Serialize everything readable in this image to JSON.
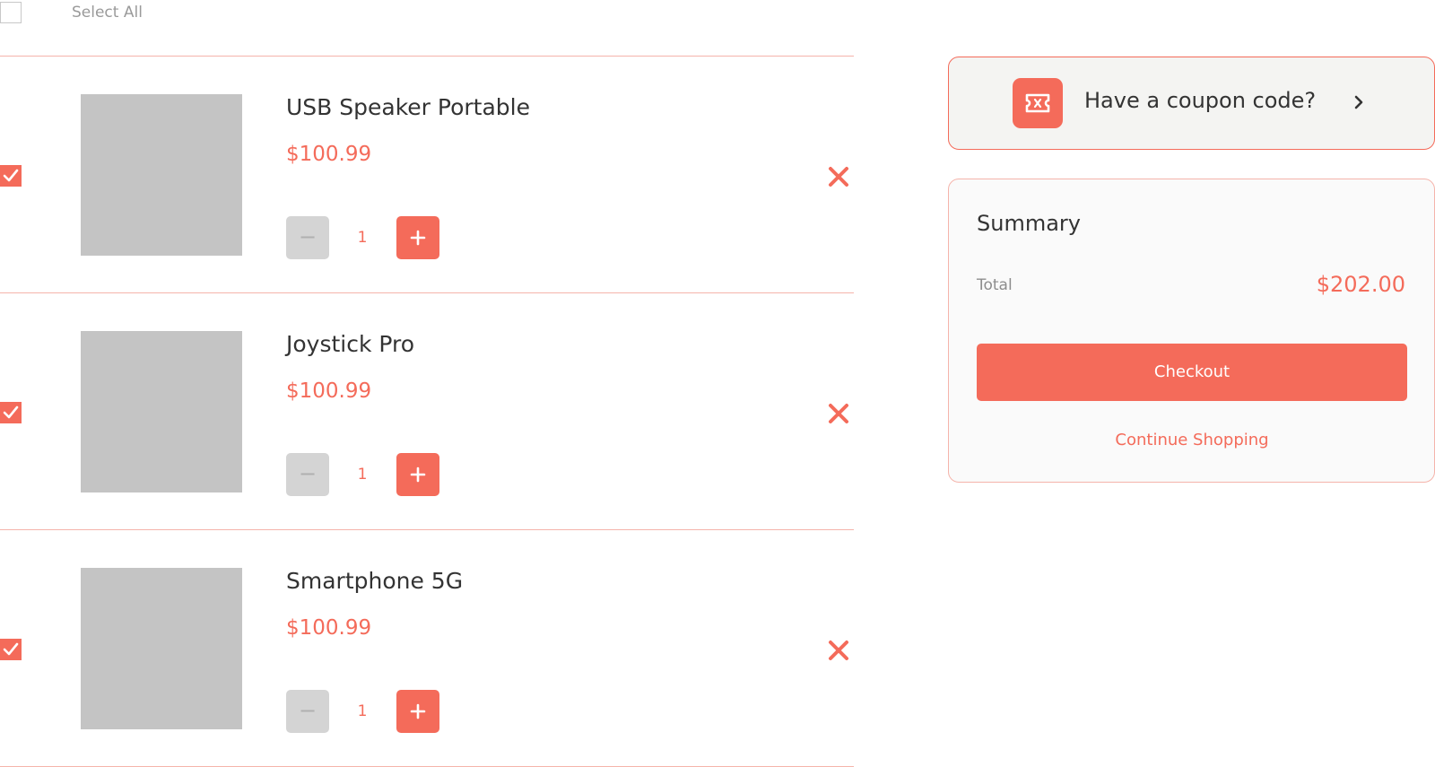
{
  "select_all": {
    "label": "Select All",
    "checked": false
  },
  "cart": {
    "items": [
      {
        "name": "USB Speaker Portable",
        "price": "$100.99",
        "quantity": "1",
        "selected": true,
        "minus_label": "−",
        "remove_icon": "close-icon",
        "plus_icon": "plus-icon"
      },
      {
        "name": "Joystick Pro",
        "price": "$100.99",
        "quantity": "1",
        "selected": true,
        "minus_label": "−",
        "remove_icon": "close-icon",
        "plus_icon": "plus-icon"
      },
      {
        "name": "Smartphone 5G",
        "price": "$100.99",
        "quantity": "1",
        "selected": true,
        "minus_label": "−",
        "remove_icon": "close-icon",
        "plus_icon": "plus-icon"
      }
    ]
  },
  "coupon": {
    "label": "Have a coupon code?",
    "icon": "ticket-icon",
    "arrow_icon": "chevron-right-icon"
  },
  "summary": {
    "title": "Summary",
    "total_label": "Total",
    "total_value": "$202.00",
    "checkout_label": "Checkout",
    "continue_label": "Continue Shopping"
  },
  "colors": {
    "accent": "#f46b5a",
    "divider": "#f5b4ab",
    "placeholder": "#c4c4c4",
    "disabled": "#d4d4d4"
  }
}
